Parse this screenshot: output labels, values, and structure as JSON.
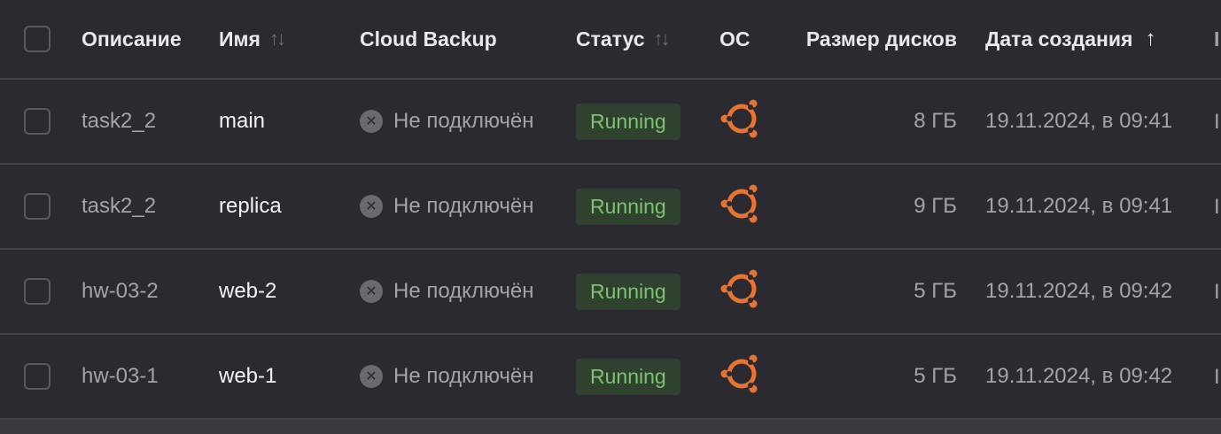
{
  "columns": {
    "description": "Описание",
    "name": "Имя",
    "backup": "Cloud Backup",
    "status": "Статус",
    "os": "ОС",
    "disk_size": "Размер дисков",
    "created": "Дата создания",
    "sort_both_icon": "↑↓",
    "sort_asc_icon": "↑",
    "next_fragment": "I"
  },
  "rows": [
    {
      "description": "task2_2",
      "name": "main",
      "backup": "Не подключён",
      "status": "Running",
      "os_icon": "ubuntu-icon",
      "disk_size": "8 ГБ",
      "created": "19.11.2024, в 09:41",
      "next_fragment": "I"
    },
    {
      "description": "task2_2",
      "name": "replica",
      "backup": "Не подключён",
      "status": "Running",
      "os_icon": "ubuntu-icon",
      "disk_size": "9 ГБ",
      "created": "19.11.2024, в 09:41",
      "next_fragment": "I"
    },
    {
      "description": "hw-03-2",
      "name": "web-2",
      "backup": "Не подключён",
      "status": "Running",
      "os_icon": "ubuntu-icon",
      "disk_size": "5 ГБ",
      "created": "19.11.2024, в 09:42",
      "next_fragment": "I"
    },
    {
      "description": "hw-03-1",
      "name": "web-1",
      "backup": "Не подключён",
      "status": "Running",
      "os_icon": "ubuntu-icon",
      "disk_size": "5 ГБ",
      "created": "19.11.2024, в 09:42",
      "next_fragment": "I"
    }
  ],
  "colors": {
    "background": "#2b2a31",
    "status_running_bg": "#30412f",
    "status_running_text": "#7ac46f",
    "ubuntu_orange": "#e9742f"
  }
}
